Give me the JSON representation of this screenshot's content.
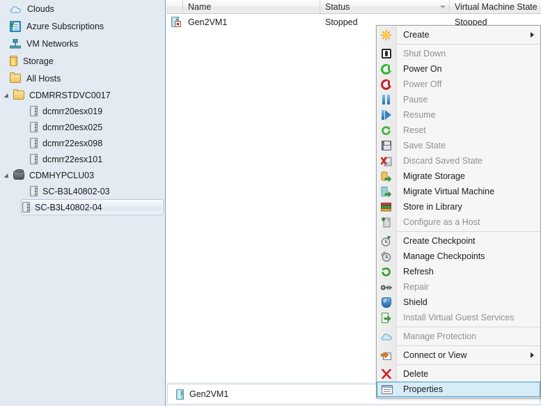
{
  "sidebar": {
    "nav": [
      {
        "label": "Clouds",
        "icon": "cloud-icon"
      },
      {
        "label": "Azure Subscriptions",
        "icon": "azure-subscriptions-icon"
      },
      {
        "label": "VM Networks",
        "icon": "vm-networks-icon"
      },
      {
        "label": "Storage",
        "icon": "storage-icon"
      },
      {
        "label": "All Hosts",
        "icon": "folder-icon"
      }
    ],
    "tree": [
      {
        "label": "CDMRRSTDVC0017",
        "icon": "folder-icon",
        "indent": 0,
        "expander": true,
        "selected": false
      },
      {
        "label": "dcmrr20esx019",
        "icon": "host-icon",
        "indent": 1,
        "expander": false,
        "selected": false
      },
      {
        "label": "dcmrr20esx025",
        "icon": "host-icon",
        "indent": 1,
        "expander": false,
        "selected": false
      },
      {
        "label": "dcmrr22esx098",
        "icon": "host-icon",
        "indent": 1,
        "expander": false,
        "selected": false
      },
      {
        "label": "dcmrr22esx101",
        "icon": "host-icon",
        "indent": 1,
        "expander": false,
        "selected": false
      },
      {
        "label": "CDMHYPCLU03",
        "icon": "cluster-icon",
        "indent": 0,
        "expander": true,
        "selected": false
      },
      {
        "label": "SC-B3L40802-03",
        "icon": "host-icon",
        "indent": 1,
        "expander": false,
        "selected": false
      },
      {
        "label": "SC-B3L40802-04",
        "icon": "host-icon",
        "indent": 1,
        "expander": false,
        "selected": true
      }
    ]
  },
  "list": {
    "columns": [
      "Name",
      "Status",
      "Virtual Machine State"
    ],
    "sorted_column": "Status",
    "rows": [
      {
        "icon": "vm-stopped-icon",
        "name": "Gen2VM1",
        "status": "Stopped",
        "vm_state": "Stopped"
      }
    ]
  },
  "details": {
    "icon": "vm-icon",
    "name": "Gen2VM1"
  },
  "context_menu": {
    "items": [
      {
        "label": "Create",
        "icon": "create-icon",
        "enabled": true,
        "submenu": true,
        "selected": false,
        "separator_after": true
      },
      {
        "label": "Shut Down",
        "icon": "shut-down-icon",
        "enabled": false,
        "submenu": false,
        "selected": false,
        "separator_after": false
      },
      {
        "label": "Power On",
        "icon": "power-on-icon",
        "enabled": true,
        "submenu": false,
        "selected": false,
        "separator_after": false
      },
      {
        "label": "Power Off",
        "icon": "power-off-icon",
        "enabled": false,
        "submenu": false,
        "selected": false,
        "separator_after": false
      },
      {
        "label": "Pause",
        "icon": "pause-icon",
        "enabled": false,
        "submenu": false,
        "selected": false,
        "separator_after": false
      },
      {
        "label": "Resume",
        "icon": "resume-icon",
        "enabled": false,
        "submenu": false,
        "selected": false,
        "separator_after": false
      },
      {
        "label": "Reset",
        "icon": "reset-icon",
        "enabled": false,
        "submenu": false,
        "selected": false,
        "separator_after": false
      },
      {
        "label": "Save State",
        "icon": "save-state-icon",
        "enabled": false,
        "submenu": false,
        "selected": false,
        "separator_after": false
      },
      {
        "label": "Discard Saved State",
        "icon": "discard-saved-state-icon",
        "enabled": false,
        "submenu": false,
        "selected": false,
        "separator_after": false
      },
      {
        "label": "Migrate Storage",
        "icon": "migrate-storage-icon",
        "enabled": true,
        "submenu": false,
        "selected": false,
        "separator_after": false
      },
      {
        "label": "Migrate Virtual Machine",
        "icon": "migrate-virtual-machine-icon",
        "enabled": true,
        "submenu": false,
        "selected": false,
        "separator_after": false
      },
      {
        "label": "Store in Library",
        "icon": "store-in-library-icon",
        "enabled": true,
        "submenu": false,
        "selected": false,
        "separator_after": false
      },
      {
        "label": "Configure as a Host",
        "icon": "configure-as-host-icon",
        "enabled": false,
        "submenu": false,
        "selected": false,
        "separator_after": true
      },
      {
        "label": "Create Checkpoint",
        "icon": "create-checkpoint-icon",
        "enabled": true,
        "submenu": false,
        "selected": false,
        "separator_after": false
      },
      {
        "label": "Manage Checkpoints",
        "icon": "manage-checkpoints-icon",
        "enabled": true,
        "submenu": false,
        "selected": false,
        "separator_after": false
      },
      {
        "label": "Refresh",
        "icon": "refresh-icon",
        "enabled": true,
        "submenu": false,
        "selected": false,
        "separator_after": false
      },
      {
        "label": "Repair",
        "icon": "repair-icon",
        "enabled": false,
        "submenu": false,
        "selected": false,
        "separator_after": false
      },
      {
        "label": "Shield",
        "icon": "shield-icon",
        "enabled": true,
        "submenu": false,
        "selected": false,
        "separator_after": false
      },
      {
        "label": "Install Virtual Guest Services",
        "icon": "install-guest-services-icon",
        "enabled": false,
        "submenu": false,
        "selected": false,
        "separator_after": true
      },
      {
        "label": "Manage Protection",
        "icon": "manage-protection-icon",
        "enabled": false,
        "submenu": false,
        "selected": false,
        "separator_after": true
      },
      {
        "label": "Connect or View",
        "icon": "connect-or-view-icon",
        "enabled": true,
        "submenu": true,
        "selected": false,
        "separator_after": true
      },
      {
        "label": "Delete",
        "icon": "delete-icon",
        "enabled": true,
        "submenu": false,
        "selected": false,
        "separator_after": false
      },
      {
        "label": "Properties",
        "icon": "properties-icon",
        "enabled": true,
        "submenu": false,
        "selected": true,
        "separator_after": false
      }
    ]
  },
  "colors": {
    "sidebar_bg": "#e3eaf2",
    "menu_bg": "#f6f6f6",
    "selection_fill": "#d6ecf7",
    "selection_border": "#3c9ad4",
    "disabled_text": "#8f8f8f"
  }
}
